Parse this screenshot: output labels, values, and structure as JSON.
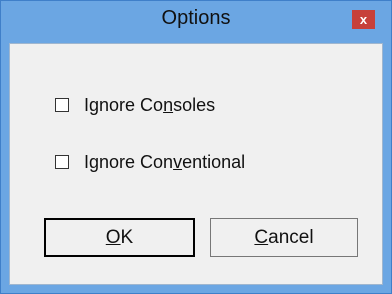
{
  "window": {
    "title": "Options",
    "close_label": "x"
  },
  "options": [
    {
      "pre": "Ignore Co",
      "mnemonic": "n",
      "post": "soles",
      "checked": false
    },
    {
      "pre": "Ignore Con",
      "mnemonic": "v",
      "post": "entional",
      "checked": false
    }
  ],
  "buttons": {
    "ok": {
      "pre": "",
      "mnemonic": "O",
      "post": "K"
    },
    "cancel": {
      "pre": "",
      "mnemonic": "C",
      "post": "ancel"
    }
  },
  "colors": {
    "frame": "#6ba6e3",
    "client": "#f0f0f0",
    "close_button": "#c7403a"
  }
}
